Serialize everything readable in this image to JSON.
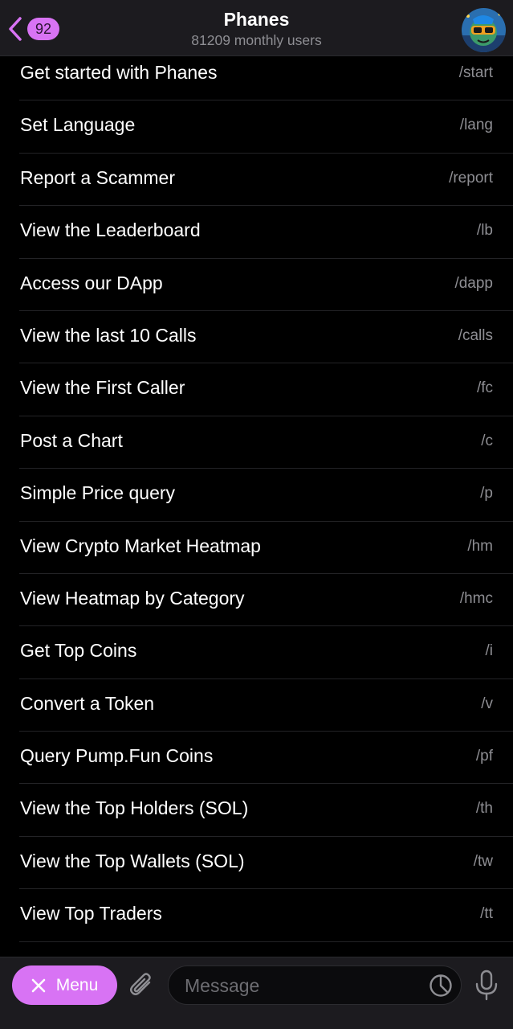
{
  "header": {
    "back_badge": "92",
    "title": "Phanes",
    "subtitle": "81209 monthly users"
  },
  "commands": [
    {
      "label": "Get started with Phanes",
      "command": "/start"
    },
    {
      "label": "Set Language",
      "command": "/lang"
    },
    {
      "label": "Report a Scammer",
      "command": "/report"
    },
    {
      "label": "View the Leaderboard",
      "command": "/lb"
    },
    {
      "label": "Access our DApp",
      "command": "/dapp"
    },
    {
      "label": "View the last 10 Calls",
      "command": "/calls"
    },
    {
      "label": "View the First Caller",
      "command": "/fc"
    },
    {
      "label": "Post a Chart",
      "command": "/c"
    },
    {
      "label": "Simple Price query",
      "command": "/p"
    },
    {
      "label": "View Crypto Market Heatmap",
      "command": "/hm"
    },
    {
      "label": "View Heatmap by Category",
      "command": "/hmc"
    },
    {
      "label": "Get Top Coins",
      "command": "/i"
    },
    {
      "label": "Convert a Token",
      "command": "/v"
    },
    {
      "label": "Query Pump.Fun Coins",
      "command": "/pf"
    },
    {
      "label": "View the Top Holders (SOL)",
      "command": "/th"
    },
    {
      "label": "View the Top Wallets (SOL)",
      "command": "/tw"
    },
    {
      "label": "View Top Traders",
      "command": "/tt"
    }
  ],
  "bottom_bar": {
    "menu_label": "Menu",
    "message_placeholder": "Message"
  },
  "colors": {
    "accent": "#d873f4",
    "background": "#000000",
    "bar_background": "#1c1b1f",
    "secondary_text": "#8e8e93"
  },
  "icons": {
    "back": "chevron-left-icon",
    "menu_close": "close-icon",
    "attach": "paperclip-icon",
    "sticker": "sticker-icon",
    "mic": "microphone-icon"
  }
}
